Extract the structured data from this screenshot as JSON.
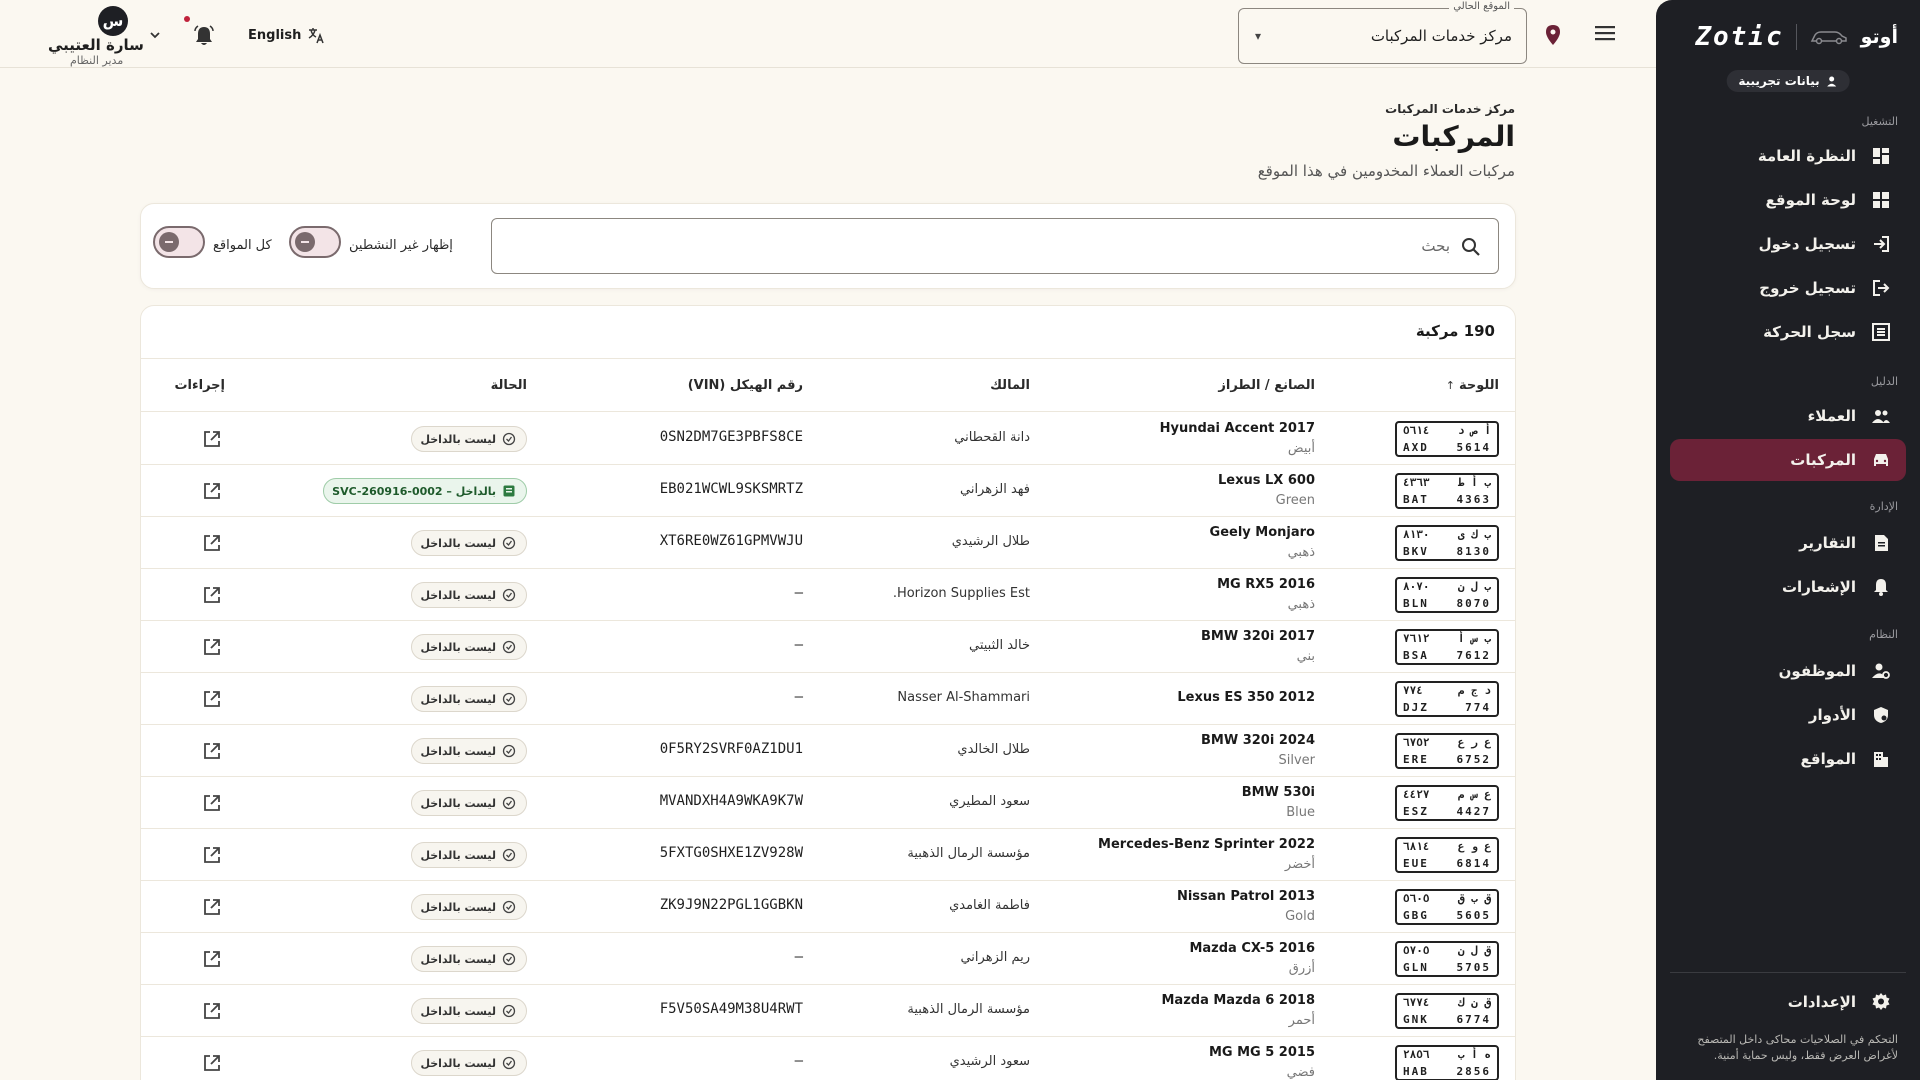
{
  "sidebar": {
    "brand_name": "أوتو",
    "brand_logo": "Zotic",
    "demo_badge": "بيانات تجريبية",
    "sections": {
      "operation": "التشغيل",
      "directory": "الدليل",
      "management": "الإدارة",
      "system": "النظام"
    },
    "items": [
      {
        "label": "النظرة العامة",
        "icon": "dashboard-icon"
      },
      {
        "label": "لوحة الموقع",
        "icon": "grid-icon"
      },
      {
        "label": "تسجيل دخول",
        "icon": "login-icon"
      },
      {
        "label": "تسجيل خروج",
        "icon": "logout-icon"
      },
      {
        "label": "سجل الحركة",
        "icon": "list-icon"
      },
      {
        "label": "العملاء",
        "icon": "people-icon"
      },
      {
        "label": "المركبات",
        "icon": "car-icon",
        "active": true
      },
      {
        "label": "التقارير",
        "icon": "report-icon"
      },
      {
        "label": "الإشعارات",
        "icon": "bell-icon"
      },
      {
        "label": "الموظفون",
        "icon": "staff-icon"
      },
      {
        "label": "الأدوار",
        "icon": "shield-icon"
      },
      {
        "label": "المواقع",
        "icon": "building-icon"
      }
    ],
    "settings_label": "الإعدادات",
    "note": "التحكم في الصلاحيات محاكى داخل المتصفح لأغراض العرض فقط، وليس حماية أمنية."
  },
  "topbar": {
    "location_label": "الموقع الحالي",
    "location_value": "مركز خدمات المركبات",
    "language": "English",
    "user_initial": "س",
    "user_name": "سارة العتيبي",
    "user_role": "مدير النظام"
  },
  "page": {
    "breadcrumb": "مركز خدمات المركبات",
    "title": "المركبات",
    "subtitle": "مركبات العملاء المخدومين في هذا الموقع"
  },
  "filters": {
    "search_placeholder": "بحث",
    "show_inactive": "إظهار غير النشطين",
    "all_locations": "كل المواقع"
  },
  "table": {
    "count": "190 مركبة",
    "columns": {
      "plate": "اللوحة",
      "make_model": "الصانع / الطراز",
      "owner": "المالك",
      "vin": "رقم الهيكل (VIN)",
      "status": "الحالة",
      "actions": "إجراءات"
    },
    "rows": [
      {
        "plate_ar": "أ ص د",
        "plate_ar_num": "٥٦١٤",
        "plate_en": "AXD",
        "plate_num": "5614",
        "model": "Hyundai Accent 2017",
        "color": "أبيض",
        "owner": "دانة القحطاني",
        "vin": "0SN2DM7GE3PBFS8CE",
        "status": "ليست بالداخل",
        "inside": false
      },
      {
        "plate_ar": "ب أ ط",
        "plate_ar_num": "٤٣٦٣",
        "plate_en": "BAT",
        "plate_num": "4363",
        "model": "Lexus LX 600",
        "color": "Green",
        "owner": "فهد الزهراني",
        "vin": "EB021WCWL9SKSMRTZ",
        "status": "بالداخل – SVC-260916-0002",
        "inside": true
      },
      {
        "plate_ar": "ب ك ى",
        "plate_ar_num": "٨١٣٠",
        "plate_en": "BKV",
        "plate_num": "8130",
        "model": "Geely Monjaro",
        "color": "ذهبي",
        "owner": "طلال الرشيدي",
        "vin": "XT6RE0WZ61GPMVWJU",
        "status": "ليست بالداخل",
        "inside": false
      },
      {
        "plate_ar": "ب ل ن",
        "plate_ar_num": "٨٠٧٠",
        "plate_en": "BLN",
        "plate_num": "8070",
        "model": "MG RX5 2016",
        "color": "ذهبي",
        "owner": "Horizon Supplies Est.",
        "vin": "—",
        "status": "ليست بالداخل",
        "inside": false
      },
      {
        "plate_ar": "ب س أ",
        "plate_ar_num": "٧٦١٢",
        "plate_en": "BSA",
        "plate_num": "7612",
        "model": "BMW 320i 2017",
        "color": "بني",
        "owner": "خالد الثبيتي",
        "vin": "—",
        "status": "ليست بالداخل",
        "inside": false
      },
      {
        "plate_ar": "د ج م",
        "plate_ar_num": "٧٧٤",
        "plate_en": "DJZ",
        "plate_num": "774",
        "model": "Lexus ES 350 2012",
        "color": "",
        "owner": "Nasser Al-Shammari",
        "vin": "—",
        "status": "ليست بالداخل",
        "inside": false
      },
      {
        "plate_ar": "ع ر ع",
        "plate_ar_num": "٦٧٥٢",
        "plate_en": "ERE",
        "plate_num": "6752",
        "model": "BMW 320i 2024",
        "color": "Silver",
        "owner": "طلال الخالدي",
        "vin": "0F5RY2SVRF0AZ1DU1",
        "status": "ليست بالداخل",
        "inside": false
      },
      {
        "plate_ar": "ع س م",
        "plate_ar_num": "٤٤٢٧",
        "plate_en": "ESZ",
        "plate_num": "4427",
        "model": "BMW 530i",
        "color": "Blue",
        "owner": "سعود المطيري",
        "vin": "MVANDXH4A9WKA9K7W",
        "status": "ليست بالداخل",
        "inside": false
      },
      {
        "plate_ar": "ع و ع",
        "plate_ar_num": "٦٨١٤",
        "plate_en": "EUE",
        "plate_num": "6814",
        "model": "Mercedes-Benz Sprinter 2022",
        "color": "أخضر",
        "owner": "مؤسسة الرمال الذهبية",
        "vin": "5FXTG0SHXE1ZV928W",
        "status": "ليست بالداخل",
        "inside": false
      },
      {
        "plate_ar": "ق ب ق",
        "plate_ar_num": "٥٦٠٥",
        "plate_en": "GBG",
        "plate_num": "5605",
        "model": "Nissan Patrol 2013",
        "color": "Gold",
        "owner": "فاطمة الغامدي",
        "vin": "ZK9J9N22PGL1GGBKN",
        "status": "ليست بالداخل",
        "inside": false
      },
      {
        "plate_ar": "ق ل ن",
        "plate_ar_num": "٥٧٠٥",
        "plate_en": "GLN",
        "plate_num": "5705",
        "model": "Mazda CX-5 2016",
        "color": "أزرق",
        "owner": "ريم الزهراني",
        "vin": "—",
        "status": "ليست بالداخل",
        "inside": false
      },
      {
        "plate_ar": "ق ن ك",
        "plate_ar_num": "٦٧٧٤",
        "plate_en": "GNK",
        "plate_num": "6774",
        "model": "Mazda Mazda 6 2018",
        "color": "أحمر",
        "owner": "مؤسسة الرمال الذهبية",
        "vin": "F5V50SA49M38U4RWT",
        "status": "ليست بالداخل",
        "inside": false
      },
      {
        "plate_ar": "ه أ ب",
        "plate_ar_num": "٢٨٥٦",
        "plate_en": "HAB",
        "plate_num": "2856",
        "model": "MG MG 5 2015",
        "color": "فضي",
        "owner": "سعود الرشيدي",
        "vin": "—",
        "status": "ليست بالداخل",
        "inside": false
      }
    ]
  },
  "colors": {
    "sidebar_bg": "#1e1f24",
    "active_item": "#6b2237",
    "page_bg": "#fbf8f1"
  }
}
